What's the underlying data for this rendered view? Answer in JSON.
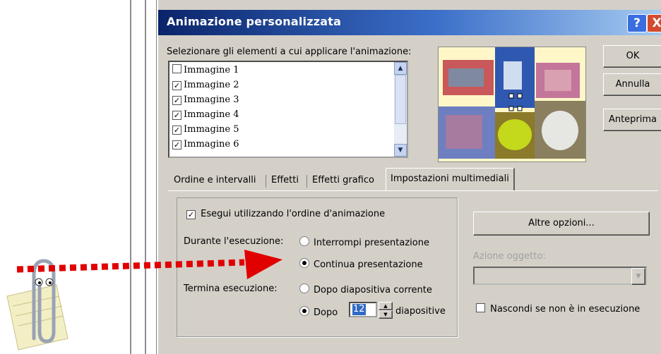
{
  "dialog": {
    "title": "Animazione personalizzata",
    "help_glyph": "?",
    "close_glyph": "X",
    "select_label": "Selezionare gli elementi a cui applicare l'animazione:",
    "items": [
      {
        "label": "Immagine 1",
        "checked": false
      },
      {
        "label": "Immagine 2",
        "checked": true
      },
      {
        "label": "Immagine 3",
        "checked": true
      },
      {
        "label": "Immagine 4",
        "checked": true
      },
      {
        "label": "Immagine 5",
        "checked": true
      },
      {
        "label": "Immagine 6",
        "checked": true
      }
    ],
    "buttons": {
      "ok": "OK",
      "cancel": "Annulla",
      "preview": "Anteprima"
    },
    "tabs": [
      "Ordine e intervalli",
      "Effetti",
      "Effetti grafico",
      "Impostazioni multimediali"
    ],
    "active_tab": "Impostazioni multimediali",
    "media": {
      "play_order_label": "Esegui utilizzando l'ordine d'animazione",
      "play_order_checked": true,
      "during_label": "Durante l'esecuzione:",
      "pause_label": "Interrompi presentazione",
      "continue_label": "Continua presentazione",
      "during_selected": "continue",
      "stop_label": "Termina esecuzione:",
      "after_current_label": "Dopo diapositiva corrente",
      "after_label": "Dopo",
      "after_value": "12",
      "slides_label": "diapositive",
      "stop_selected": "after",
      "more_options": "Altre opzioni...",
      "object_action_label": "Azione oggetto:",
      "hide_label": "Nascondi se non è in esecuzione",
      "hide_checked": false
    }
  },
  "annotation": {
    "arrow_color": "#e00000"
  }
}
